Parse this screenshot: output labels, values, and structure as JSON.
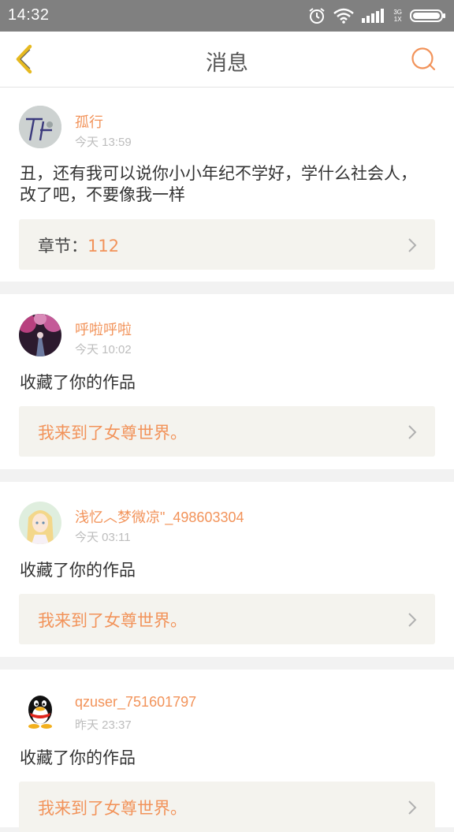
{
  "status": {
    "time": "14:32",
    "network_top": "3G",
    "network_bottom": "1X",
    "icons": [
      "alarm-icon",
      "wifi-icon",
      "signal-icon",
      "battery-icon"
    ]
  },
  "navbar": {
    "title": "消息",
    "back_icon": "chevron-left-icon",
    "search_icon": "search-icon"
  },
  "colors": {
    "accent": "#f2935a",
    "back_icon": "#e6b920",
    "statusbar": "#808080"
  },
  "messages": [
    {
      "username": "孤行",
      "time": "今天 13:59",
      "content": "丑，还有我可以说你小小年纪不学好，学什么社会人，改了吧，不要像我一样",
      "ref_label": "章节：",
      "ref_value": "112"
    },
    {
      "username": "呼啦呼啦",
      "time": "今天 10:02",
      "content": "收藏了你的作品",
      "ref_label": "",
      "ref_value": "我来到了女尊世界。"
    },
    {
      "username": "浅忆︿梦微凉\"_498603304",
      "time": "今天 03:11",
      "content": "收藏了你的作品",
      "ref_label": "",
      "ref_value": "我来到了女尊世界。"
    },
    {
      "username": "qzuser_751601797",
      "time": "昨天 23:37",
      "content": "收藏了你的作品",
      "ref_label": "",
      "ref_value": "我来到了女尊世界。"
    }
  ]
}
